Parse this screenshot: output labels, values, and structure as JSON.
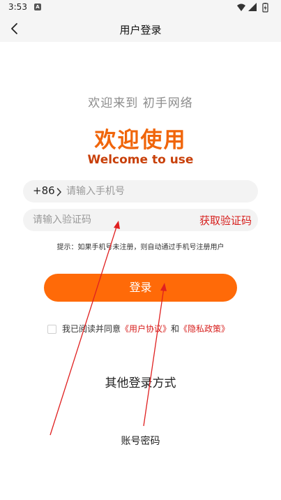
{
  "status_bar": {
    "time": "3:53",
    "notification_icon": "A"
  },
  "nav": {
    "title": "用户登录"
  },
  "header": {
    "greeting": "欢迎来到 初手网络",
    "welcome_cn": "欢迎使用",
    "welcome_en": "Welcome to use"
  },
  "form": {
    "country_code": "+86",
    "phone_placeholder": "请输入手机号",
    "code_placeholder": "请输入验证码",
    "get_code_label": "获取验证码",
    "hint": "提示：如果手机号未注册，则自动通过手机号注册用户",
    "login_label": "登录"
  },
  "agreement": {
    "prefix": "我已阅读并同意",
    "user_agreement": "《用户协议》",
    "and": "和",
    "privacy_policy": "《隐私政策》",
    "checked": false
  },
  "other_login": {
    "title": "其他登录方式",
    "account_password": "账号密码"
  },
  "colors": {
    "accent": "#ff6a08",
    "brand_text": "#f0650a",
    "link": "#d7201e",
    "annotation_arrow": "#e02020"
  }
}
